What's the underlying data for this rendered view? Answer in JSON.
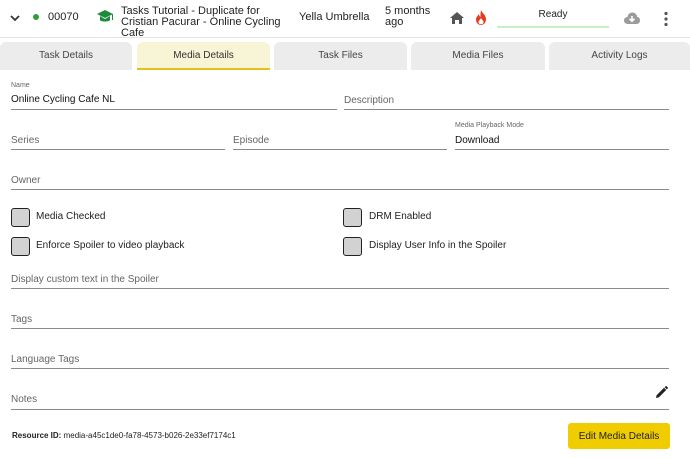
{
  "header": {
    "task_id": "00070",
    "title": "Tasks Tutorial - Duplicate for Cristian Pacurar - Online Cycling Cafe",
    "client": "Yella Umbrella",
    "age": "5 months ago",
    "status": "Ready",
    "status_color": "#c7f0c7",
    "dot_color": "#2e9d3a",
    "icons": [
      "chevron-down-icon",
      "graduation-cap-icon",
      "home-icon",
      "fire-icon",
      "cloud-download-icon",
      "more-vert-icon"
    ]
  },
  "tabs": [
    {
      "label": "Task Details",
      "active": false
    },
    {
      "label": "Media Details",
      "active": true
    },
    {
      "label": "Task Files",
      "active": false
    },
    {
      "label": "Media Files",
      "active": false
    },
    {
      "label": "Activity Logs",
      "active": false
    }
  ],
  "form": {
    "name": {
      "label": "Name",
      "value": "Online Cycling Cafe NL"
    },
    "description": {
      "placeholder": "Description"
    },
    "series": {
      "placeholder": "Series"
    },
    "episode": {
      "placeholder": "Episode"
    },
    "playback_mode": {
      "label": "Media Playback Mode",
      "value": "Download"
    },
    "owner": {
      "placeholder": "Owner"
    },
    "checkboxes": {
      "media_checked": "Media Checked",
      "drm_enabled": "DRM Enabled",
      "enforce_spoiler": "Enforce Spoiler to video playback",
      "display_user_info": "Display User Info in the Spoiler"
    },
    "spoiler_text": {
      "placeholder": "Display custom text in the Spoiler"
    },
    "tags": {
      "placeholder": "Tags"
    },
    "language_tags": {
      "placeholder": "Language Tags"
    },
    "notes": {
      "placeholder": "Notes"
    }
  },
  "footer": {
    "resource_label": "Resource ID:",
    "resource_id": "media-a45c1de0-fa78-4573-b026-2e33ef7174c1",
    "edit_button": "Edit Media Details",
    "button_color": "#f0cd00"
  }
}
